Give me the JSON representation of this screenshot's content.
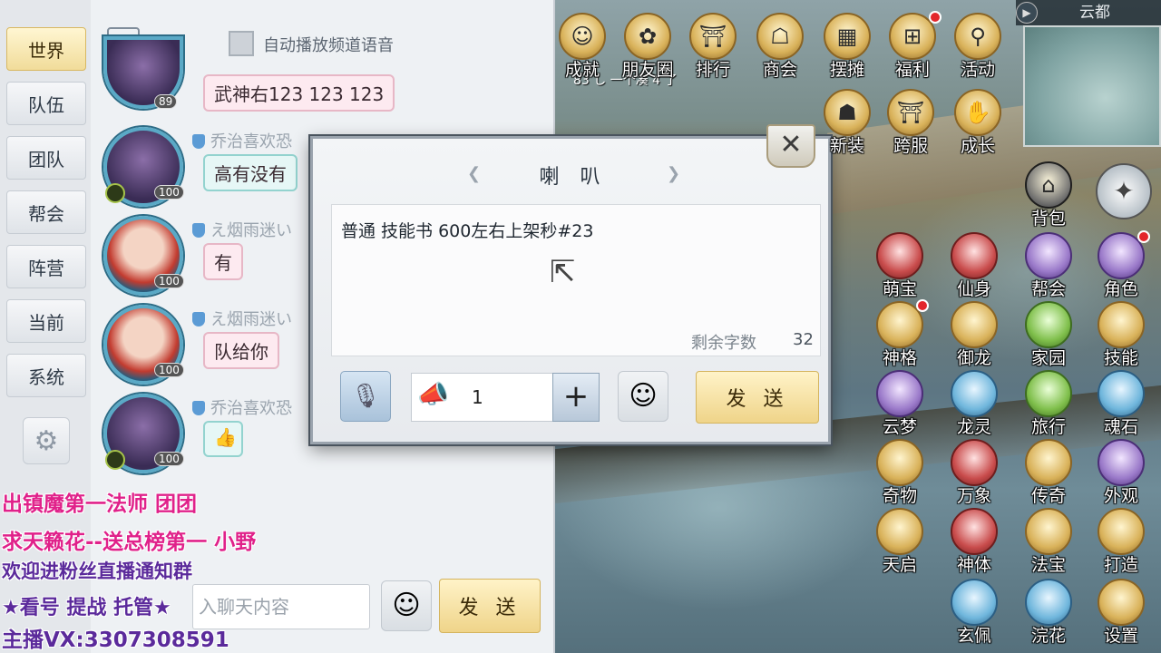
{
  "channels": {
    "items": [
      {
        "label": "世界",
        "active": true
      },
      {
        "label": "队伍",
        "active": false
      },
      {
        "label": "团队",
        "active": false
      },
      {
        "label": "帮会",
        "active": false
      },
      {
        "label": "阵营",
        "active": false
      },
      {
        "label": "当前",
        "active": false
      },
      {
        "label": "系统",
        "active": false
      }
    ]
  },
  "chat_header": {
    "autoplay_label": "自动播放频道语音"
  },
  "messages": [
    {
      "sender": "",
      "text": "武神右123 123   123",
      "level": "89"
    },
    {
      "sender": "乔治喜欢恐",
      "text": "高有没有",
      "level": "100"
    },
    {
      "sender": "え烟雨迷い",
      "text": "有",
      "level": "100"
    },
    {
      "sender": "え烟雨迷い",
      "text": "队给你",
      "level": "100"
    },
    {
      "sender": "乔治喜欢恐",
      "text": "",
      "level": "100"
    }
  ],
  "chat_input": {
    "placeholder": "入聊天内容",
    "send_label": "发 送"
  },
  "overlay": {
    "line1": "出镇魔第一法师 团团",
    "line2": "求天籁花--送总榜第一 小野",
    "line3": "欢迎进粉丝直播通知群",
    "line4": "★看号 提战 托管★",
    "line5": "主播VX:3307308591"
  },
  "horn_dialog": {
    "title": "喇 叭",
    "text": "普通 技能书 600左右上架秒#23",
    "remaining_label": "剩余字数",
    "remaining_count": "32",
    "quantity": "1",
    "send_label": "发 送",
    "close": "✕",
    "plus": "+"
  },
  "hud": {
    "map_name": "云都",
    "player_info": "83 し 一个凑 4 了",
    "top_row": [
      {
        "label": "成就",
        "icon": "achievement-icon",
        "glyph": "☺"
      },
      {
        "label": "朋友圈",
        "icon": "friends-circle-icon",
        "glyph": "✿"
      },
      {
        "label": "排行",
        "icon": "ranking-icon",
        "glyph": "⛩"
      },
      {
        "label": "商会",
        "icon": "shop-icon",
        "glyph": "☖"
      },
      {
        "label": "摆摊",
        "icon": "stall-icon",
        "glyph": "▦"
      },
      {
        "label": "福利",
        "icon": "gift-icon",
        "glyph": "⊞"
      },
      {
        "label": "活动",
        "icon": "activity-icon",
        "glyph": "⚲"
      }
    ],
    "second_row": [
      {
        "label": "新装",
        "icon": "new-outfit-icon",
        "glyph": "☗"
      },
      {
        "label": "跨服",
        "icon": "cross-server-icon",
        "glyph": "⛩"
      },
      {
        "label": "成长",
        "icon": "growth-icon",
        "glyph": "✋"
      }
    ],
    "bag": {
      "label": "背包",
      "icon": "bag-icon",
      "glyph": "⌂"
    },
    "grid": [
      {
        "label": "萌宝",
        "icon": "pet-icon"
      },
      {
        "label": "仙身",
        "icon": "immortal-icon"
      },
      {
        "label": "帮会",
        "icon": "guild-icon"
      },
      {
        "label": "角色",
        "icon": "character-icon"
      },
      {
        "label": "神格",
        "icon": "divinity-icon"
      },
      {
        "label": "御龙",
        "icon": "dragon-ride-icon"
      },
      {
        "label": "家园",
        "icon": "home-icon"
      },
      {
        "label": "技能",
        "icon": "skill-icon"
      },
      {
        "label": "云梦",
        "icon": "cloud-dream-icon"
      },
      {
        "label": "龙灵",
        "icon": "dragon-spirit-icon"
      },
      {
        "label": "旅行",
        "icon": "travel-icon"
      },
      {
        "label": "魂石",
        "icon": "soul-stone-icon"
      },
      {
        "label": "奇物",
        "icon": "artifact-icon"
      },
      {
        "label": "万象",
        "icon": "panorama-icon"
      },
      {
        "label": "传奇",
        "icon": "legend-icon"
      },
      {
        "label": "外观",
        "icon": "appearance-icon"
      },
      {
        "label": "天启",
        "icon": "revelation-icon"
      },
      {
        "label": "神体",
        "icon": "divine-body-icon"
      },
      {
        "label": "法宝",
        "icon": "treasure-icon"
      },
      {
        "label": "打造",
        "icon": "forge-icon"
      },
      {
        "label": "玄佩",
        "icon": "pendant-icon"
      },
      {
        "label": "浣花",
        "icon": "flower-icon"
      },
      {
        "label": "设置",
        "icon": "settings-icon"
      }
    ]
  }
}
